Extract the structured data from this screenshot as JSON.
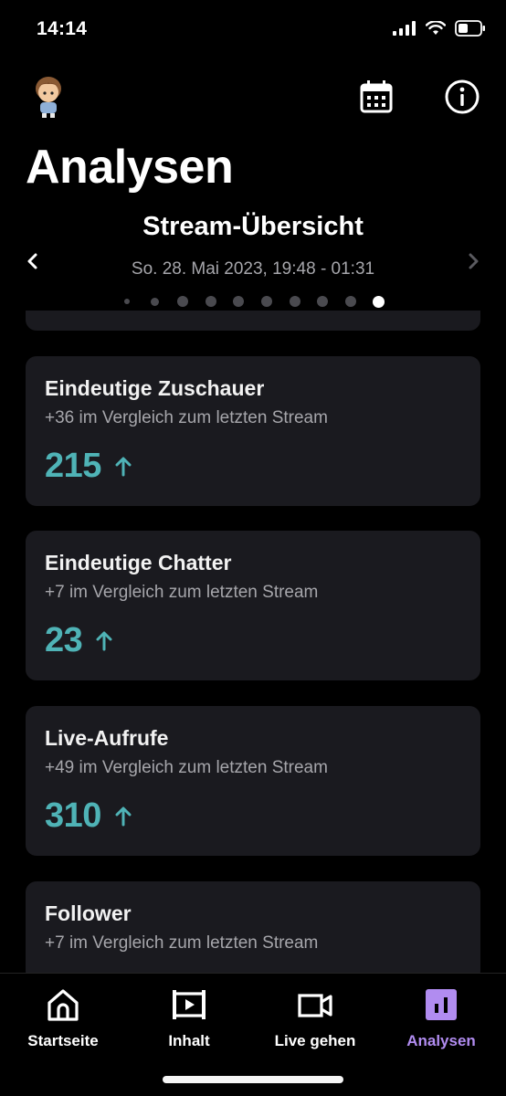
{
  "status_bar": {
    "time": "14:14"
  },
  "header": {
    "avatar_icon": "avatar",
    "calendar_icon": "calendar-icon",
    "info_icon": "info-icon"
  },
  "page": {
    "title": "Analysen"
  },
  "overview": {
    "title": "Stream-Übersicht",
    "date_range": "So. 28. Mai 2023, 19:48 - 01:31",
    "pager_count": 10,
    "pager_active": 9
  },
  "cards": [
    {
      "title": "Eindeutige Zuschauer",
      "subtitle": "+36 im Vergleich zum letzten Stream",
      "value": "215",
      "trend": "up"
    },
    {
      "title": "Eindeutige Chatter",
      "subtitle": "+7 im Vergleich zum letzten Stream",
      "value": "23",
      "trend": "up"
    },
    {
      "title": "Live-Aufrufe",
      "subtitle": "+49 im Vergleich zum letzten Stream",
      "value": "310",
      "trend": "up"
    },
    {
      "title": "Follower",
      "subtitle": "+7 im Vergleich zum letzten Stream"
    }
  ],
  "tabs": [
    {
      "label": "Startseite",
      "icon": "home-icon"
    },
    {
      "label": "Inhalt",
      "icon": "film-icon"
    },
    {
      "label": "Live gehen",
      "icon": "video-camera-icon"
    },
    {
      "label": "Analysen",
      "icon": "analytics-icon",
      "active": true
    }
  ],
  "colors": {
    "accent_value": "#4fb3b6",
    "accent_tab": "#b18cf0",
    "card_bg": "#1a1a1f"
  }
}
